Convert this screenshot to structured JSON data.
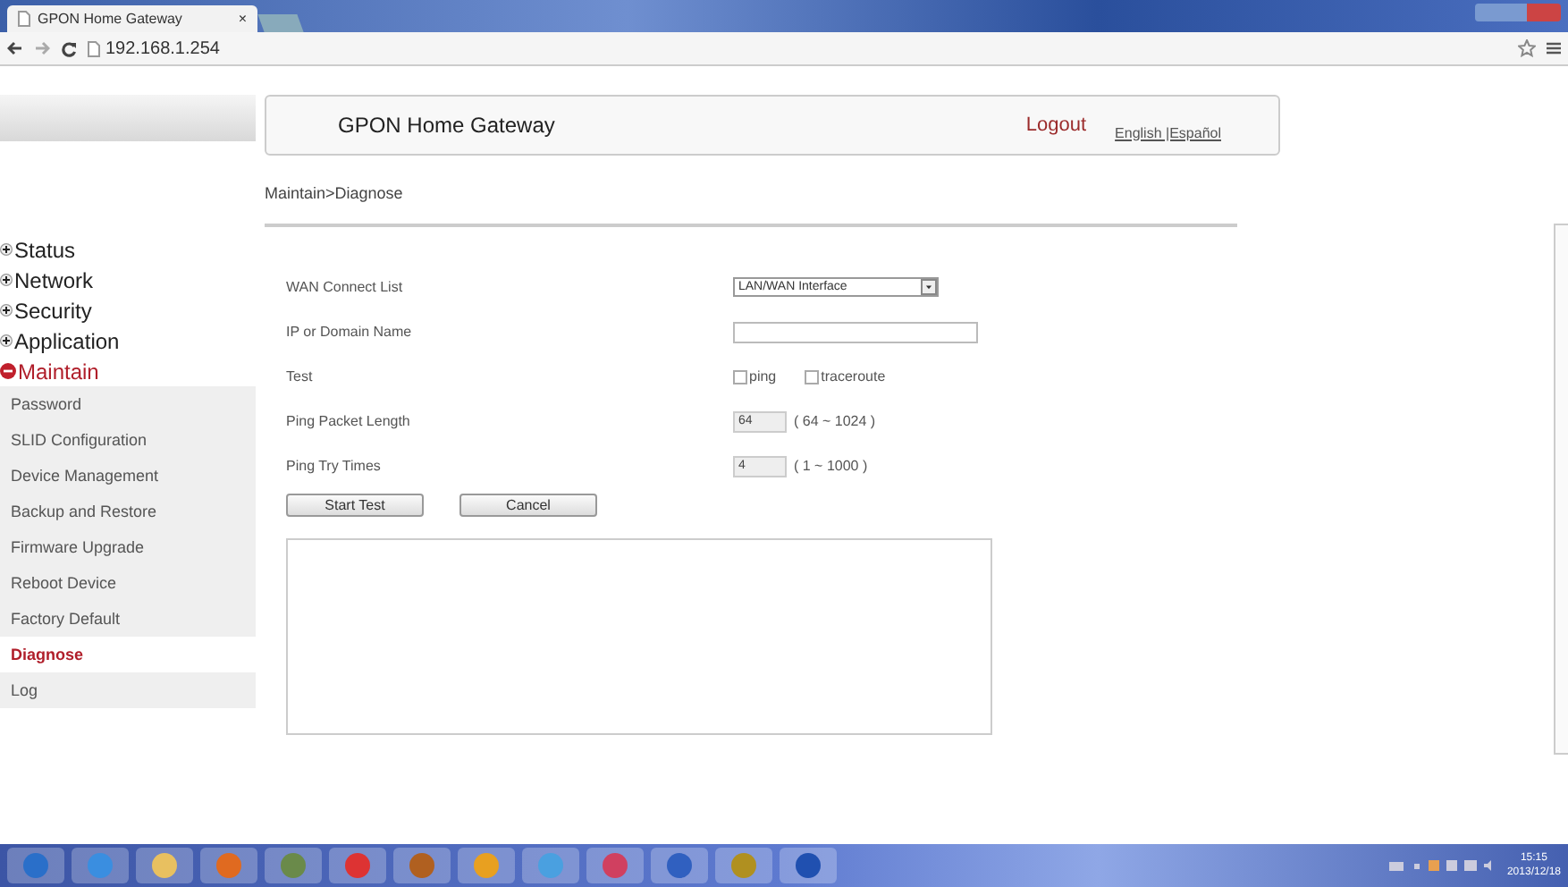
{
  "browser": {
    "tab_title": "GPON Home Gateway",
    "tab_close": "×",
    "url": "192.168.1.254"
  },
  "header": {
    "title": "GPON Home Gateway",
    "logout": "Logout",
    "languages": "English |Español"
  },
  "breadcrumb": "Maintain>Diagnose",
  "nav": [
    {
      "label": "Status",
      "expanded": false
    },
    {
      "label": "Network",
      "expanded": false
    },
    {
      "label": "Security",
      "expanded": false
    },
    {
      "label": "Application",
      "expanded": false
    },
    {
      "label": "Maintain",
      "expanded": true,
      "children": [
        {
          "label": "Password",
          "selected": false
        },
        {
          "label": "SLID Configuration",
          "selected": false
        },
        {
          "label": "Device Management",
          "selected": false
        },
        {
          "label": "Backup and Restore",
          "selected": false
        },
        {
          "label": "Firmware Upgrade",
          "selected": false
        },
        {
          "label": "Reboot Device",
          "selected": false
        },
        {
          "label": "Factory Default",
          "selected": false
        },
        {
          "label": "Diagnose",
          "selected": true
        },
        {
          "label": "Log",
          "selected": false
        }
      ]
    }
  ],
  "form": [
    {
      "kind": "select",
      "label": "WAN Connect List",
      "value": "LAN/WAN Interface"
    },
    {
      "kind": "text",
      "label": "IP or Domain Name"
    },
    {
      "kind": "checks",
      "label": "Test",
      "options": [
        {
          "label": "ping",
          "checked": false
        },
        {
          "label": "traceroute",
          "checked": false
        }
      ]
    },
    {
      "kind": "number",
      "label": "Ping Packet Length",
      "value": "64",
      "range": "( 64 ~ 1024 )"
    },
    {
      "kind": "number",
      "label": "Ping Try Times",
      "value": "4",
      "range": "( 1 ~ 1000 )"
    }
  ],
  "buttons": [
    "Start Test",
    "Cancel"
  ],
  "taskbar": {
    "time": "15:15",
    "date": "2013/12/18"
  }
}
